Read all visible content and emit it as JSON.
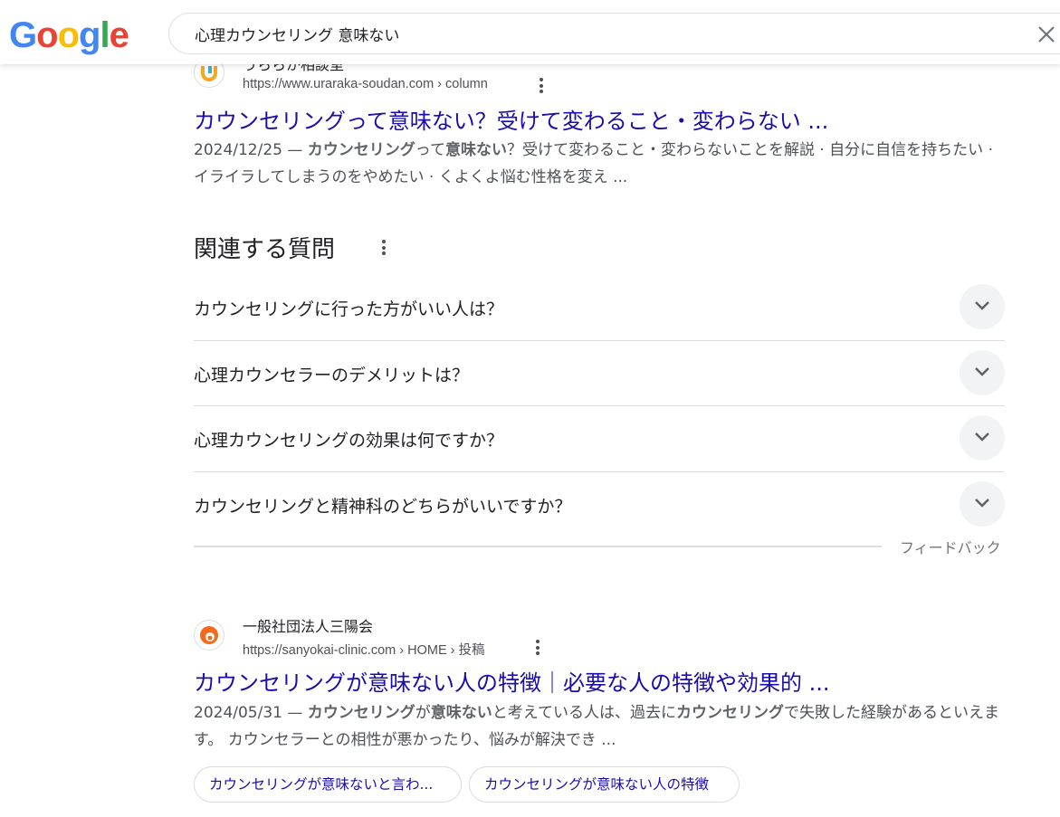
{
  "header": {
    "logo_letters": [
      "G",
      "o",
      "o",
      "g",
      "l",
      "e"
    ],
    "logo_colors": [
      "#4285F4",
      "#EA4335",
      "#FBBC05",
      "#4285F4",
      "#34A853",
      "#EA4335"
    ],
    "search_query": "心理カウンセリング 意味ない"
  },
  "result1": {
    "site_name": "うららか相談室",
    "url": "https://www.uraraka-soudan.com › column",
    "title": "カウンセリングって意味ない？受けて変わること・変わらない ...",
    "snippet_date": "2024/12/25 — ",
    "snippet_b1": "カウンセリング",
    "snippet_t1": "って",
    "snippet_b2": "意味ない",
    "snippet_t2": "？受けて変わること・変わらないことを解説 · 自分に自信を持ちたい · イライラしてしまうのをやめたい · くよくよ悩む性格を変え ..."
  },
  "paa": {
    "heading": "関連する質問",
    "questions": [
      "カウンセリングに行った方がいい人は？",
      "心理カウンセラーのデメリットは？",
      "心理カウンセリングの効果は何ですか？",
      "カウンセリングと精神科のどちらがいいですか？"
    ],
    "feedback": "フィードバック"
  },
  "result2": {
    "site_name": "一般社団法人三陽会",
    "url": "https://sanyokai-clinic.com › HOME › 投稿",
    "title": "カウンセリングが意味ない人の特徴｜必要な人の特徴や効果的 ...",
    "snippet_date": "2024/05/31 — ",
    "snippet_b1": "カウンセリング",
    "snippet_t1": "が",
    "snippet_b2": "意味ない",
    "snippet_t2": "と考えている人は、過去に",
    "snippet_b3": "カウンセリング",
    "snippet_t3": "で失敗した経験があるといえます。 カウンセラーとの相性が悪かったり、悩みが解決でき ...",
    "chips": [
      "カウンセリングが意味ないと言わ...",
      "カウンセリングが意味ない人の特徴"
    ]
  }
}
